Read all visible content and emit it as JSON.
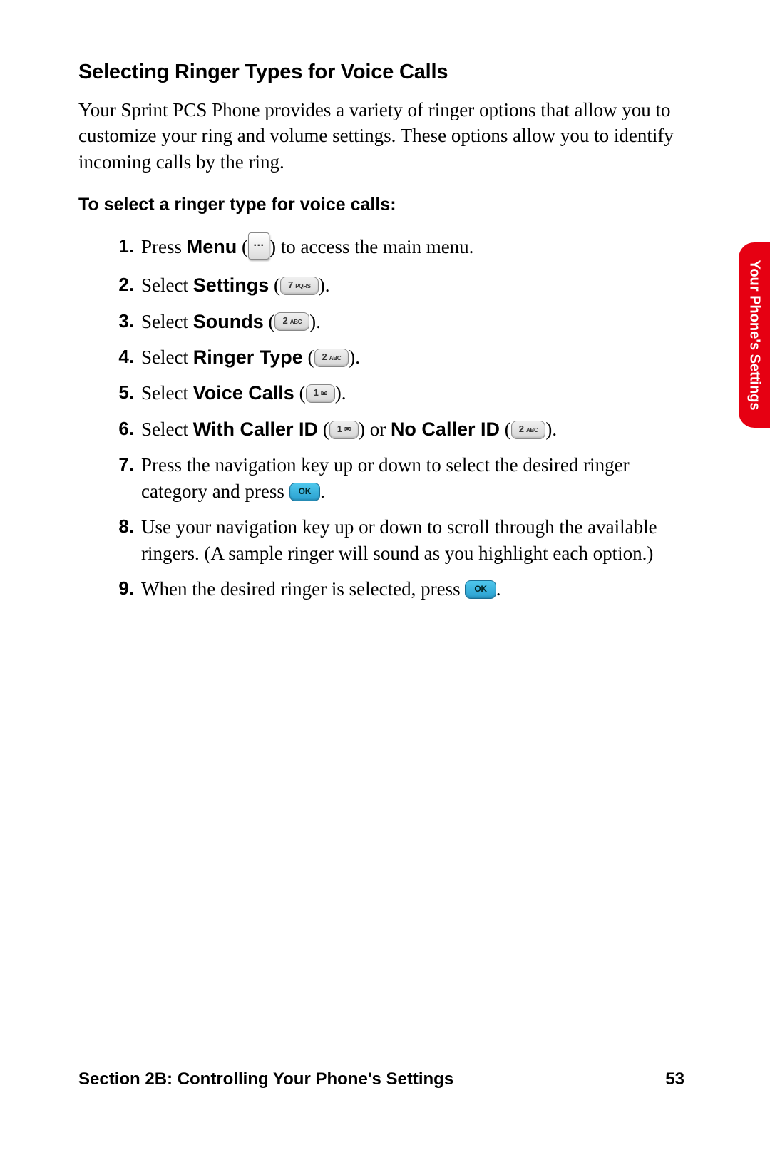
{
  "title": "Selecting Ringer Types for Voice Calls",
  "intro": "Your Sprint PCS Phone provides a variety of ringer options that allow you to customize your ring and volume settings. These options allow you to identify incoming calls by the ring.",
  "subhead": "To select a ringer type for voice calls:",
  "steps": {
    "s1_a": "Press ",
    "s1_b": "Menu",
    "s1_c": " to access the main menu.",
    "s2_a": "Select ",
    "s2_b": "Settings",
    "s3_a": "Select ",
    "s3_b": "Sounds",
    "s4_a": "Select ",
    "s4_b": "Ringer Type",
    "s5_a": "Select ",
    "s5_b": "Voice Calls",
    "s6_a": "Select ",
    "s6_b": "With Caller ID",
    "s6_c": " or ",
    "s6_d": "No Caller ID",
    "s7": "Press the navigation key up or down to select the desired ringer category and press ",
    "s8": "Use your navigation key up or down to scroll through the available ringers. (A sample ringer will sound as you highlight each option.)",
    "s9": "When the desired ringer is selected, press "
  },
  "nums": {
    "n1": "1.",
    "n2": "2.",
    "n3": "3.",
    "n4": "4.",
    "n5": "5.",
    "n6": "6.",
    "n7": "7.",
    "n8": "8.",
    "n9": "9."
  },
  "keys": {
    "menu_dots": "···",
    "ok": "OK"
  },
  "side_tab": "Your Phone's Settings",
  "footer_left": "Section 2B: Controlling Your Phone's Settings",
  "footer_right": "53",
  "paren_open": " (",
  "paren_close": ").",
  "paren_close_nodot": ") ",
  "period": "."
}
